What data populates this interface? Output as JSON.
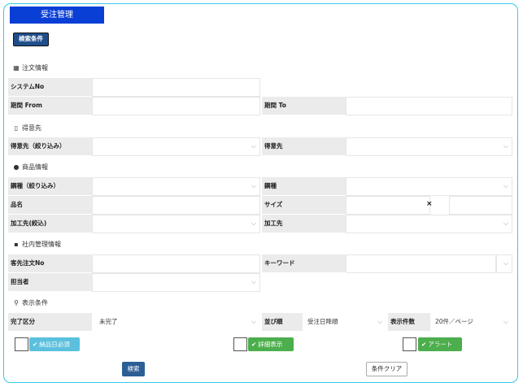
{
  "title": "受注管理",
  "search_condition_button": "検索条件",
  "sections": {
    "order_info": "注文情報",
    "customer": "得意先",
    "product_info": "商品情報",
    "internal_info": "社内管理情報",
    "display_condition": "表示条件"
  },
  "order": {
    "system_no_label": "システムNo",
    "period_from_label": "期間 From",
    "period_to_label": "期間 To"
  },
  "customer": {
    "filter_label": "得意先（絞り込み）",
    "customer_label": "得意先"
  },
  "product": {
    "type_filter_label": "鋼種（絞り込み）",
    "type_label": "鋼種",
    "name_label": "品名",
    "size_label": "サイズ",
    "size_separator": "×",
    "processor_filter_label": "加工先(絞込)",
    "processor_label": "加工先"
  },
  "internal": {
    "client_order_no_label": "客先注文No",
    "keyword_label": "キーワード",
    "staff_label": "担当者"
  },
  "display": {
    "completion_label": "完了区分",
    "completion_value": "未完了",
    "sort_label": "並び順",
    "sort_value": "受注日降順",
    "count_label": "表示件数",
    "count_value": "20件／ページ"
  },
  "toggles": {
    "delivery_required": "納品日必須",
    "detail_display": "詳細表示",
    "alert": "アラート"
  },
  "colors": {
    "title_bg": "#0a3fd6",
    "delivery_tag": "#5bc0de",
    "detail_tag": "#4cae4c",
    "alert_tag": "#4cae4c",
    "search_btn": "#2c5f95"
  },
  "buttons": {
    "search": "検索",
    "clear": "条件クリア"
  }
}
